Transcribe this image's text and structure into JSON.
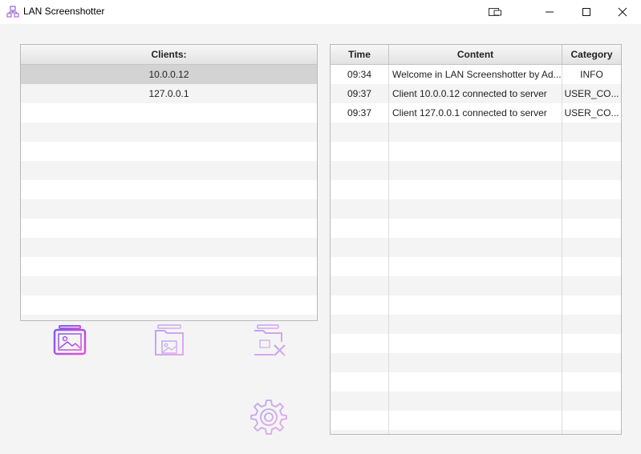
{
  "window": {
    "title": "LAN Screenshotter"
  },
  "clients": {
    "header": "Clients:",
    "items": [
      "10.0.0.12",
      "127.0.0.1"
    ],
    "selected_index": 0,
    "empty_rows": 12
  },
  "log": {
    "columns": [
      "Time",
      "Content",
      "Category"
    ],
    "rows": [
      {
        "time": "09:34",
        "content": "Welcome in LAN Screenshotter by Ad...",
        "category": "INFO"
      },
      {
        "time": "09:37",
        "content": "Client 10.0.0.12 connected to server",
        "category": "USER_CO..."
      },
      {
        "time": "09:37",
        "content": "Client 127.0.0.1 connected to server",
        "category": "USER_CO..."
      }
    ],
    "empty_rows": 17
  },
  "actions": {
    "take_screenshot": "screenshot-icon",
    "open_folder": "folder-image-icon",
    "clear_folder": "folder-delete-icon",
    "settings": "gear-icon"
  },
  "colors": {
    "accent_start": "#8e5bf5",
    "accent_end": "#e04fd7",
    "disabled": "#cdb8f0"
  }
}
